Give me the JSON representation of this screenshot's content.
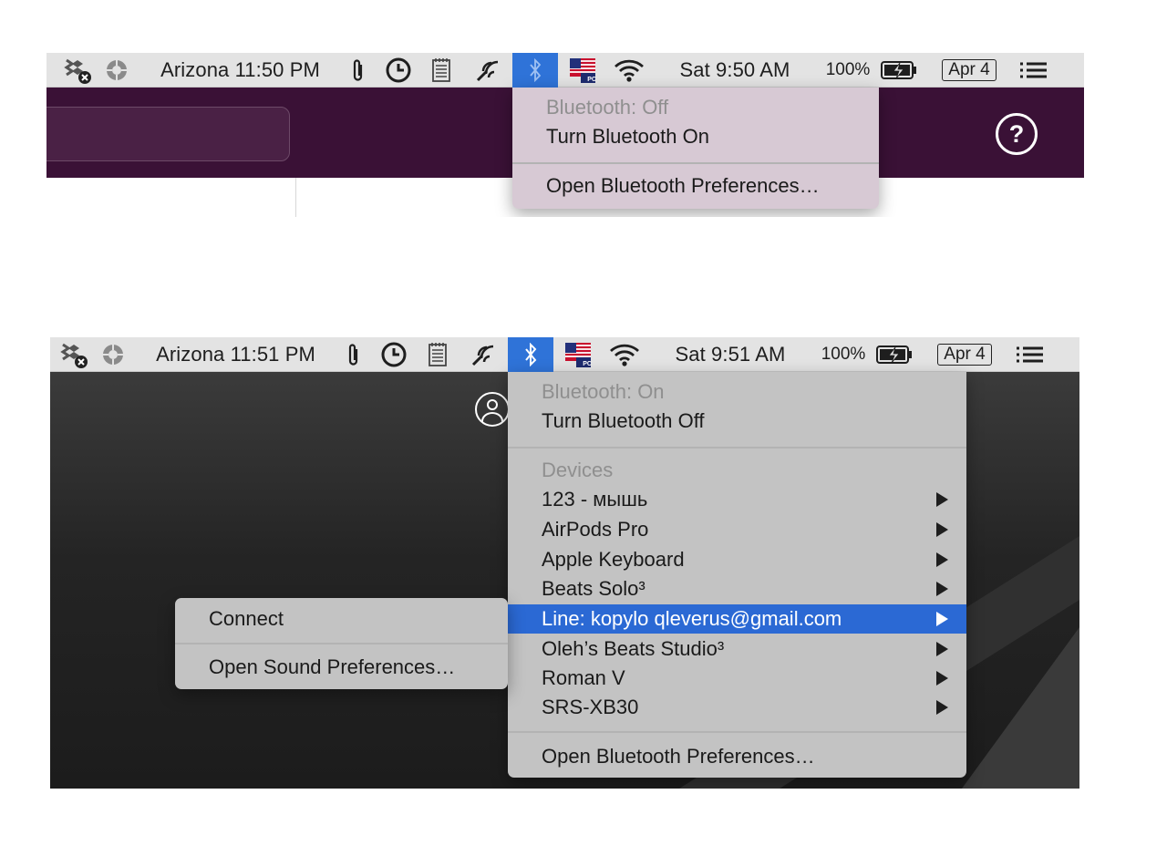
{
  "colors": {
    "menubar_bg": "#e3e3e3",
    "selection_blue": "#2f73d8",
    "app_header_purple": "#3a1136",
    "dark_background": "#2a2a2a"
  },
  "top": {
    "menubar": {
      "timezone_clock": "Arizona 11:50 PM",
      "clock": "Sat 9:50 AM",
      "battery_percent": "100%",
      "date_badge": "Apr 4",
      "flag_label": "PC"
    },
    "bluetooth_menu": {
      "status": "Bluetooth: Off",
      "toggle": "Turn Bluetooth On",
      "preferences": "Open Bluetooth Preferences…"
    },
    "help_icon_glyph": "?"
  },
  "bottom": {
    "menubar": {
      "timezone_clock": "Arizona 11:51 PM",
      "clock": "Sat 9:51 AM",
      "battery_percent": "100%",
      "date_badge": "Apr 4",
      "flag_label": "PC"
    },
    "bluetooth_menu": {
      "status": "Bluetooth: On",
      "toggle": "Turn Bluetooth Off",
      "devices_header": "Devices",
      "devices": [
        "123 - мышь",
        "AirPods Pro",
        "Apple Keyboard",
        "Beats Solo³",
        "Line: kopylo qleverus@gmail.com",
        "Oleh’s Beats Studio³",
        "Roman V",
        "SRS-XB30"
      ],
      "highlighted_device": "Line: kopylo qleverus@gmail.com",
      "preferences": "Open Bluetooth Preferences…"
    },
    "submenu": {
      "connect": "Connect",
      "sound_preferences": "Open Sound Preferences…"
    }
  }
}
